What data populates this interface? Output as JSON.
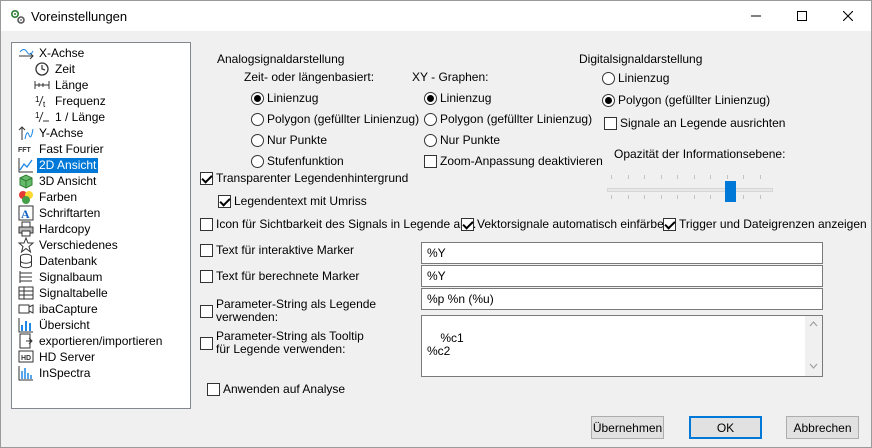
{
  "window": {
    "title": "Voreinstellungen"
  },
  "tree": {
    "items": [
      {
        "label": "X-Achse",
        "icon": "x-axis-icon",
        "level": 0
      },
      {
        "label": "Zeit",
        "icon": "clock-icon",
        "level": 1
      },
      {
        "label": "Länge",
        "icon": "length-icon",
        "level": 1
      },
      {
        "label": "Frequenz",
        "icon": "frequency-icon",
        "level": 1
      },
      {
        "label": "1 / Länge",
        "icon": "inverse-length-icon",
        "level": 1
      },
      {
        "label": "Y-Achse",
        "icon": "y-axis-icon",
        "level": 0
      },
      {
        "label": "Fast Fourier",
        "icon": "fft-icon",
        "level": 0
      },
      {
        "label": "2D Ansicht",
        "icon": "chart-2d-icon",
        "level": 0,
        "selected": true
      },
      {
        "label": "3D Ansicht",
        "icon": "cube-3d-icon",
        "level": 0
      },
      {
        "label": "Farben",
        "icon": "colors-icon",
        "level": 0
      },
      {
        "label": "Schriftarten",
        "icon": "font-icon",
        "level": 0
      },
      {
        "label": "Hardcopy",
        "icon": "printer-icon",
        "level": 0
      },
      {
        "label": "Verschiedenes",
        "icon": "star-icon",
        "level": 0
      },
      {
        "label": "Datenbank",
        "icon": "database-icon",
        "level": 0
      },
      {
        "label": "Signalbaum",
        "icon": "signal-tree-icon",
        "level": 0
      },
      {
        "label": "Signaltabelle",
        "icon": "signal-table-icon",
        "level": 0
      },
      {
        "label": "ibaCapture",
        "icon": "camera-icon",
        "level": 0
      },
      {
        "label": "Übersicht",
        "icon": "overview-chart-icon",
        "level": 0
      },
      {
        "label": "exportieren/importieren",
        "icon": "export-import-icon",
        "level": 0
      },
      {
        "label": "HD Server",
        "icon": "hd-server-icon",
        "level": 0
      },
      {
        "label": "InSpectra",
        "icon": "inspectra-icon",
        "level": 0
      }
    ]
  },
  "analog": {
    "group_label": "Analogsignaldarstellung",
    "time_based_label": "Zeit- oder längenbasiert:",
    "time_options": [
      {
        "label": "Linienzug",
        "checked": true
      },
      {
        "label": "Polygon (gefüllter Linienzug)",
        "checked": false
      },
      {
        "label": "Nur Punkte",
        "checked": false
      },
      {
        "label": "Stufenfunktion",
        "checked": false
      }
    ],
    "xy_label": "XY - Graphen:",
    "xy_options": [
      {
        "label": "Linienzug",
        "checked": true
      },
      {
        "label": "Polygon (gefüllter Linienzug)",
        "checked": false
      },
      {
        "label": "Nur Punkte",
        "checked": false
      }
    ],
    "zoom_adjust": {
      "label": "Zoom-Anpassung deaktivieren",
      "checked": false
    }
  },
  "digital": {
    "group_label": "Digitalsignaldarstellung",
    "options": [
      {
        "label": "Linienzug",
        "checked": false
      },
      {
        "label": "Polygon (gefüllter Linienzug)",
        "checked": true
      }
    ],
    "align_legend": {
      "label": "Signale an Legende ausrichten",
      "checked": false
    },
    "opacity_label": "Opazität der Informationsebene:",
    "opacity_value": 0.75
  },
  "checks": {
    "transparent_bg": {
      "label": "Transparenter Legendenhintergrund",
      "checked": true
    },
    "legend_outline": {
      "label": "Legendentext mit Umriss",
      "checked": true
    },
    "visibility_icon": {
      "label": "Icon für Sichtbarkeit des Signals in Legende anz.",
      "checked": false
    },
    "vector_color": {
      "label": "Vektorsignale automatisch einfärben",
      "checked": true
    },
    "trigger_limits": {
      "label": "Trigger und Dateigrenzen anzeigen",
      "checked": true
    },
    "interactive_marker": {
      "label": "Text für interaktive Marker",
      "checked": false,
      "value": "%Y"
    },
    "computed_marker": {
      "label": "Text für berechnete Marker",
      "checked": false,
      "value": "%Y"
    },
    "param_legend": {
      "label_line1": "Parameter-String als Legende",
      "label_line2": "verwenden:",
      "checked": false,
      "value": "%p %n (%u)"
    },
    "param_tooltip": {
      "label_line1": "Parameter-String als Tooltip",
      "label_line2": "für Legende verwenden:",
      "checked": false,
      "value": "%c1\n%c2"
    },
    "apply_analysis": {
      "label": "Anwenden auf Analyse",
      "checked": false
    }
  },
  "buttons": {
    "apply": "Übernehmen",
    "ok": "OK",
    "cancel": "Abbrechen"
  },
  "colors": {
    "accent": "#0078d7",
    "selection": "#0078d7"
  }
}
